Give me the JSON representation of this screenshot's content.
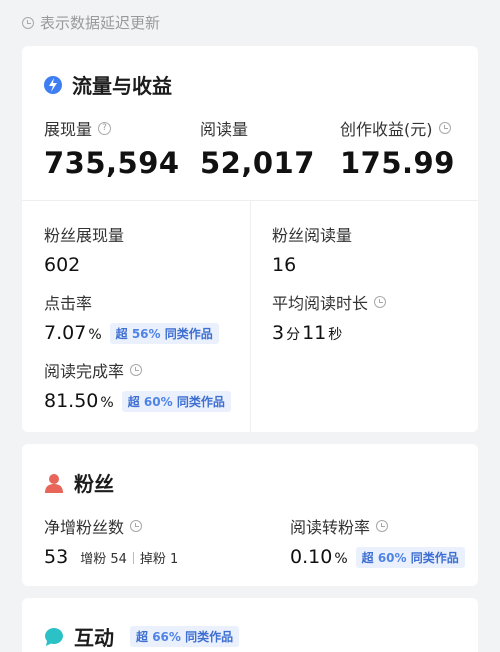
{
  "notice": {
    "text": "表示数据延迟更新",
    "icon": "clock-icon"
  },
  "traffic": {
    "title": "流量与收益",
    "icon": "bolt-icon",
    "icon_color": "#3f7ef2",
    "impressions": {
      "label": "展现量",
      "value": "735,594"
    },
    "reads": {
      "label": "阅读量",
      "value": "52,017"
    },
    "earnings": {
      "label": "创作收益(元)",
      "value": "175.99"
    },
    "fan_impressions": {
      "label": "粉丝展现量",
      "value": "602"
    },
    "fan_reads": {
      "label": "粉丝阅读量",
      "value": "16"
    },
    "ctr": {
      "label": "点击率",
      "value": "7.07",
      "unit": "%",
      "badge_prefix": "超",
      "badge_value": "56%",
      "badge_suffix": "同类作品"
    },
    "avg_read_time": {
      "label": "平均阅读时长",
      "min": "3",
      "min_unit": "分",
      "sec": "11",
      "sec_unit": "秒"
    },
    "completion": {
      "label": "阅读完成率",
      "value": "81.50",
      "unit": "%",
      "badge_prefix": "超",
      "badge_value": "60%",
      "badge_suffix": "同类作品"
    }
  },
  "fans": {
    "title": "粉丝",
    "icon": "user-icon",
    "icon_color": "#e8655a",
    "net_gain": {
      "label": "净增粉丝数",
      "value": "53",
      "gain_label": "增粉",
      "gain_value": "54",
      "loss_label": "掉粉",
      "loss_value": "1"
    },
    "conversion": {
      "label": "阅读转粉率",
      "value": "0.10",
      "unit": "%",
      "badge_prefix": "超",
      "badge_value": "60%",
      "badge_suffix": "同类作品"
    }
  },
  "interaction": {
    "title": "互动",
    "icon": "chat-icon",
    "icon_color": "#2cc1c7",
    "badge_prefix": "超",
    "badge_value": "66%",
    "badge_suffix": "同类作品"
  }
}
